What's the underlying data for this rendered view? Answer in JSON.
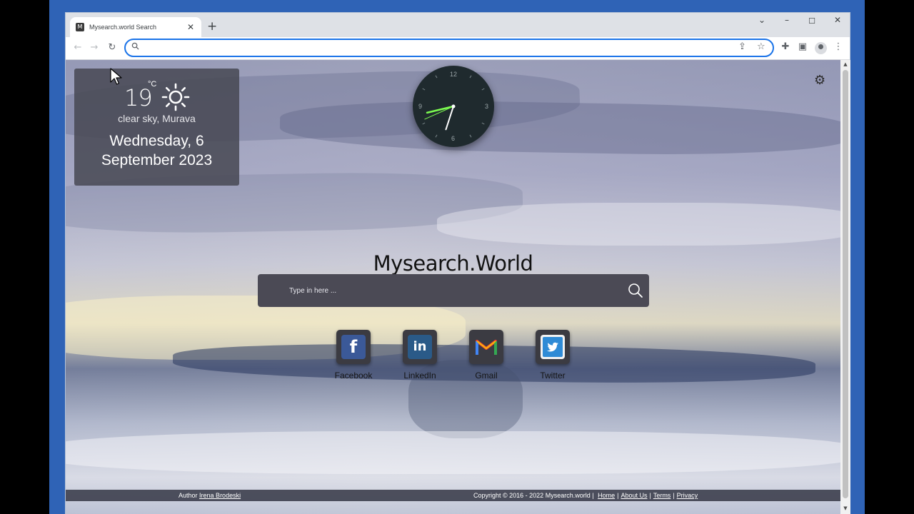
{
  "browser": {
    "tab_title": "Mysearch.world Search",
    "favicon_letter": "M",
    "tab_close_icon": "close-icon",
    "new_tab_icon": "plus-icon",
    "address_value": "",
    "window_controls": [
      "chevron-down-icon",
      "minimize-icon",
      "maximize-icon",
      "close-icon"
    ]
  },
  "weather": {
    "temperature": "19",
    "unit": "°C",
    "icon": "sun-icon",
    "condition": "clear sky, Murava",
    "date": "Wednesday, 6 September 2023"
  },
  "clock": {
    "numbers": [
      "12",
      "3",
      "6",
      "9"
    ],
    "hour_value": 8,
    "minute_value": 33,
    "second_value": 41,
    "accent_color": "#7CFC50"
  },
  "main": {
    "brand": "Mysearch.World",
    "search_placeholder": "Type in here ...",
    "settings_icon": "gear-icon"
  },
  "social": [
    {
      "label": "Facebook",
      "glyph": "f",
      "icon": "facebook-icon",
      "color": "#3b5998"
    },
    {
      "label": "LinkedIn",
      "glyph": "in",
      "icon": "linkedin-icon",
      "color": "#2a5a88"
    },
    {
      "label": "Gmail",
      "glyph": "M",
      "icon": "gmail-icon",
      "color": "#ffffff"
    },
    {
      "label": "Twitter",
      "glyph": "t",
      "icon": "twitter-icon",
      "color": "#2f8bd6"
    }
  ],
  "footer": {
    "author_prefix": "Author",
    "author_name": "Irena Brodeski",
    "copyright": "Copyright © 2016 - 2022 Mysearch.world |",
    "links": [
      "Home",
      "About Us",
      "Terms",
      "Privacy"
    ]
  }
}
